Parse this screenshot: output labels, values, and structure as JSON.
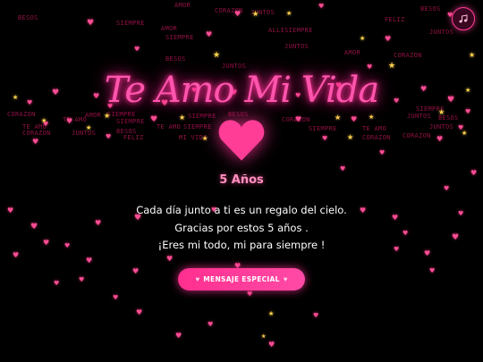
{
  "header": {
    "title": "Te Amo Mi Vida",
    "music_icon": "music-note-icon"
  },
  "main": {
    "years": "5 Años",
    "messages": [
      "Cada día junto a ti es un regalo del cielo.",
      "Gracias por estos 5 años .",
      "¡Eres mi todo, mi para siempre !"
    ],
    "button_label": "MENSAJE ESPECIAL"
  },
  "background": {
    "words": [
      "AMOR",
      "CORAZON",
      "BESOS",
      "SIEMPRE",
      "JUNTOS",
      "AMOR",
      "SIEMPRE",
      "ALLISIEMPRE",
      "JUNTOS",
      "AMOR",
      "BESOS",
      "JUNTOS",
      "CORAZON",
      "JUNTOS",
      "BESOS",
      "FELIZ",
      "CORAZON",
      "SIEMPRE",
      "TE AMO",
      "CORAZON",
      "BESOS",
      "TE AMO",
      "SIEMPRE",
      "JUNTOS",
      "SIEMPRE",
      "MI VIDA",
      "FELIZ",
      "JUNTOS",
      "TE AMO",
      "CORAZON",
      "SIEMPRE",
      "TE AMO",
      "CORAZON",
      "JUNTOS",
      "BESOS",
      "AMOR",
      "SIEMPRE",
      "BESOS",
      "SIEMPRE",
      "CORAZON"
    ]
  },
  "colors": {
    "accent": "#ff3d96",
    "title": "#ff55ad",
    "background": "#000000",
    "star": "#ffd54f"
  }
}
